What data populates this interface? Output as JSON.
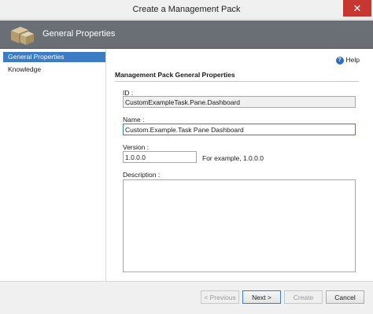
{
  "window": {
    "title": "Create a Management Pack",
    "close_glyph": "✕"
  },
  "header": {
    "title": "General Properties",
    "icon": "management-pack-boxes-icon"
  },
  "sidebar": {
    "items": [
      {
        "label": "General Properties",
        "active": true
      },
      {
        "label": "Knowledge",
        "active": false
      }
    ]
  },
  "content": {
    "help_label": "Help",
    "help_glyph": "?",
    "section_heading": "Management Pack General Properties",
    "id_field": {
      "label": "ID :",
      "value": "CustomExampleTask.Pane.Dashboard"
    },
    "name_field": {
      "label": "Name :",
      "value": "Custom.Example.Task Pane Dashboard"
    },
    "version_field": {
      "label": "Version :",
      "value": "1.0.0.0",
      "example": "For example, 1.0.0.0"
    },
    "description_field": {
      "label": "Description :",
      "value": ""
    }
  },
  "footer": {
    "previous_label": "< Previous",
    "next_label": "Next >",
    "create_label": "Create",
    "cancel_label": "Cancel"
  },
  "colors": {
    "accent": "#3b7cc4",
    "header_bg": "#6a6f75",
    "close_button": "#c7372f"
  }
}
